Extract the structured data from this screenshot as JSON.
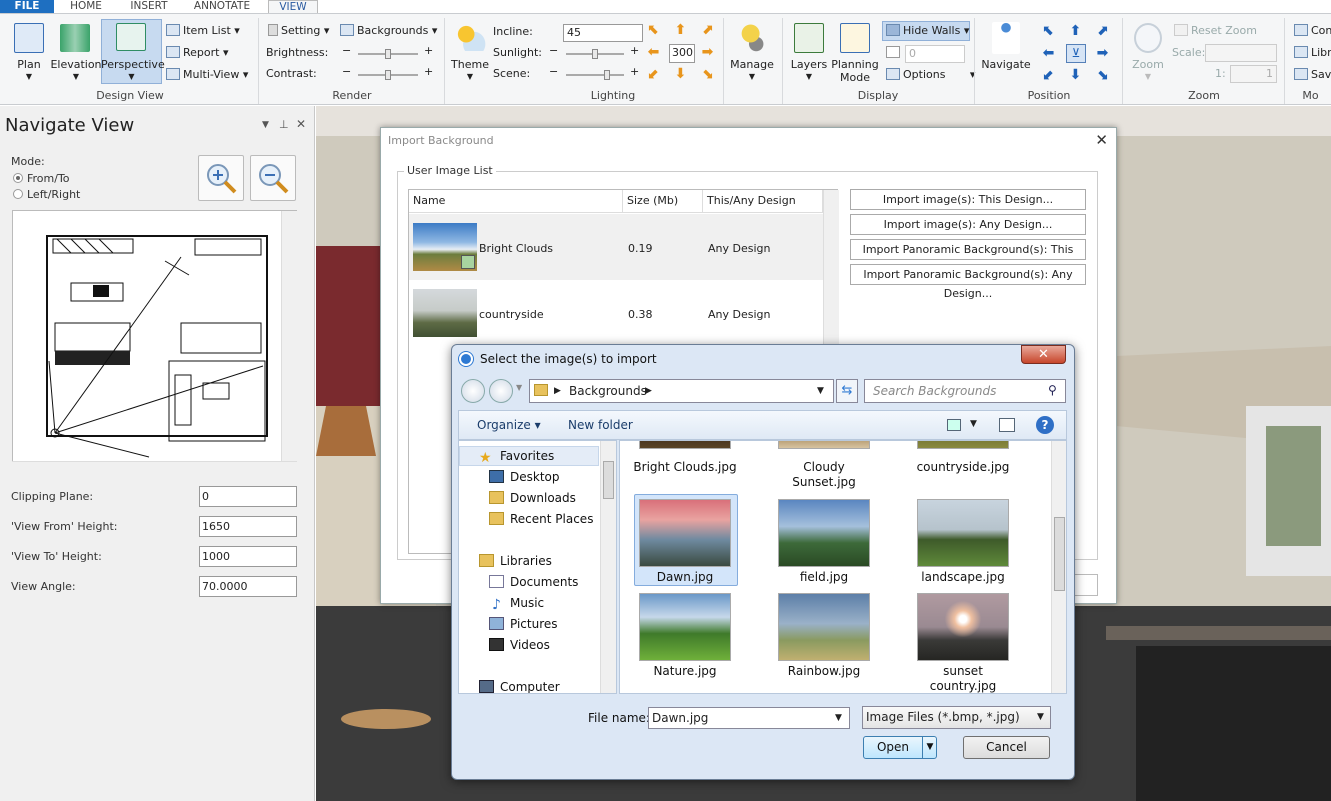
{
  "tabs": [
    "FILE",
    "HOME",
    "INSERT",
    "ANNOTATE",
    "VIEW"
  ],
  "ribbon": {
    "design_view": {
      "label": "Design View",
      "plan": "Plan",
      "elevation": "Elevation",
      "perspective": "Perspective",
      "item_list": "Item List",
      "report": "Report",
      "multi_view": "Multi-View"
    },
    "render": {
      "label": "Render",
      "setting": "Setting",
      "backgrounds": "Backgrounds",
      "brightness": "Brightness:",
      "contrast": "Contrast:"
    },
    "lighting": {
      "label": "Lighting",
      "theme": "Theme",
      "incline_label": "Incline:",
      "incline_value": "45",
      "sunlight": "Sunlight:",
      "scene": "Scene:",
      "rotation_value": "300"
    },
    "manage": {
      "label": "Manage"
    },
    "display": {
      "label": "Display",
      "layers": "Layers",
      "planning_mode_1": "Planning",
      "planning_mode_2": "Mode",
      "hide_walls": "Hide Walls",
      "grid_value": "0",
      "options": "Options"
    },
    "position": {
      "label": "Position",
      "navigate": "Navigate"
    },
    "zoom": {
      "label": "Zoom",
      "zoom": "Zoom",
      "reset_zoom": "Reset Zoom",
      "scale": "Scale:",
      "one": "1:",
      "one_value": "1"
    },
    "more": {
      "label": "Mo",
      "con": "Con",
      "lib": "Libr",
      "sav": "Sav"
    }
  },
  "navigate_view": {
    "title": "Navigate View",
    "mode_label": "Mode:",
    "from_to": "From/To",
    "left_right": "Left/Right",
    "clipping_plane_label": "Clipping Plane:",
    "clipping_plane_value": "0",
    "view_from_label": "'View From' Height:",
    "view_from_value": "1650",
    "view_to_label": "'View To' Height:",
    "view_to_value": "1000",
    "view_angle_label": "View Angle:",
    "view_angle_value": "70.0000"
  },
  "import_background": {
    "title": "Import Background",
    "group_label": "User Image List",
    "columns": [
      "Name",
      "Size (Mb)",
      "This/Any Design"
    ],
    "rows": [
      {
        "name": "Bright Clouds",
        "size": "0.19",
        "scope": "Any Design"
      },
      {
        "name": "countryside",
        "size": "0.38",
        "scope": "Any Design"
      }
    ],
    "buttons": [
      "Import image(s): This Design...",
      "Import image(s): Any Design...",
      "Import Panoramic Background(s): This Design...",
      "Import Panoramic Background(s): Any Design..."
    ]
  },
  "file_dialog": {
    "title": "Select the image(s) to import",
    "breadcrumb": "Backgrounds",
    "search_placeholder": "Search Backgrounds",
    "organize": "Organize",
    "new_folder": "New folder",
    "nav": {
      "favorites": "Favorites",
      "desktop": "Desktop",
      "downloads": "Downloads",
      "recent": "Recent Places",
      "libraries": "Libraries",
      "documents": "Documents",
      "music": "Music",
      "pictures": "Pictures",
      "videos": "Videos",
      "computer": "Computer"
    },
    "files_top": [
      "Bright Clouds.jpg",
      "Cloudy\nSunset.jpg",
      "countryside.jpg"
    ],
    "files": [
      {
        "name": "Dawn.jpg",
        "selected": true
      },
      {
        "name": "field.jpg"
      },
      {
        "name": "landscape.jpg"
      },
      {
        "name": "Nature.jpg"
      },
      {
        "name": "Rainbow.jpg"
      },
      {
        "name": "sunset\ncountry.jpg"
      }
    ],
    "file_name_label": "File name:",
    "file_name_value": "Dawn.jpg",
    "file_type": "Image Files (*.bmp, *.jpg)",
    "open": "Open",
    "cancel": "Cancel"
  }
}
